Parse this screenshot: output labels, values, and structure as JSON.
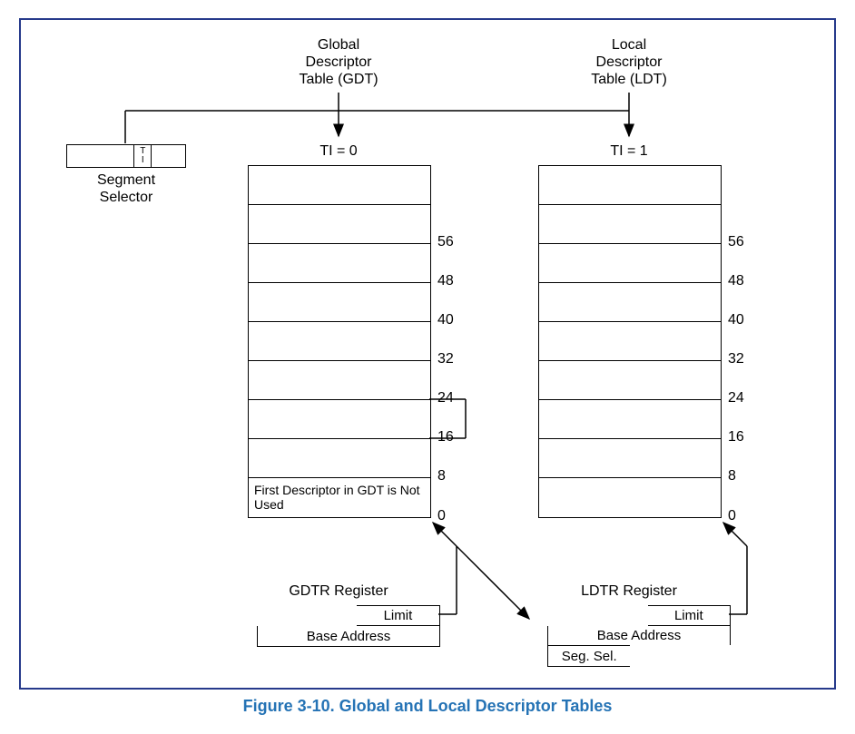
{
  "caption": "Figure 3-10.  Global and Local Descriptor Tables",
  "gdt": {
    "title_line1": "Global",
    "title_line2": "Descriptor",
    "title_line3": "Table (GDT)",
    "ti_label": "TI = 0",
    "first_desc_text": "First Descriptor in GDT is Not Used",
    "offsets": [
      "56",
      "48",
      "40",
      "32",
      "24",
      "16",
      "8",
      "0"
    ],
    "register_title": "GDTR Register",
    "limit": "Limit",
    "base": "Base Address"
  },
  "ldt": {
    "title_line1": "Local",
    "title_line2": "Descriptor",
    "title_line3": "Table (LDT)",
    "ti_label": "TI = 1",
    "offsets": [
      "56",
      "48",
      "40",
      "32",
      "24",
      "16",
      "8",
      "0"
    ],
    "register_title": "LDTR Register",
    "limit": "Limit",
    "base": "Base Address",
    "segsel": "Seg. Sel."
  },
  "selector": {
    "label_line1": "Segment",
    "label_line2": "Selector",
    "ti_t": "T",
    "ti_i": "I"
  }
}
